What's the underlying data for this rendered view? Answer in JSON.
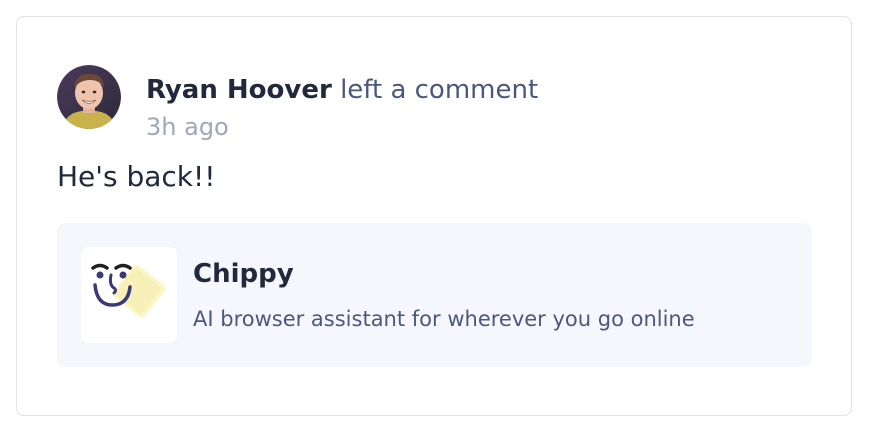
{
  "comment": {
    "author_name": "Ryan Hoover",
    "action_text": "left a comment",
    "timestamp": "3h ago",
    "body": "He's back!!"
  },
  "product": {
    "name": "Chippy",
    "tagline": "AI browser assistant for wherever you go online",
    "icon": "chippy-logo-icon"
  },
  "colors": {
    "text_primary": "#21293c",
    "text_secondary": "#4b587c",
    "text_muted": "#a0a7b8",
    "card_border": "#e1e3ea",
    "product_bg": "#f5f7fc"
  }
}
